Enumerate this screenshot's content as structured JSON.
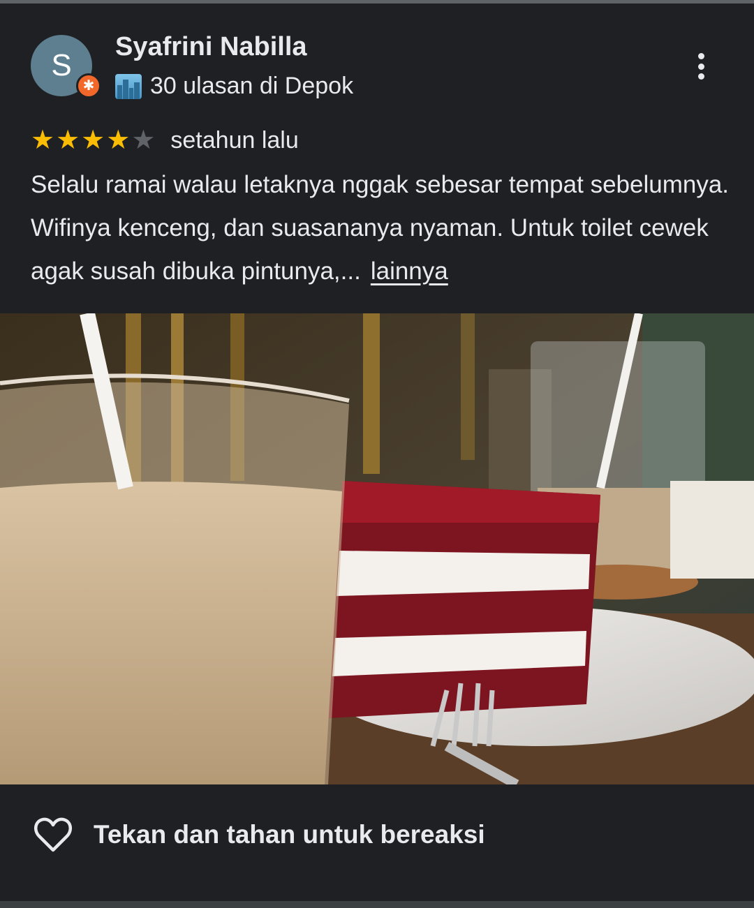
{
  "review": {
    "author_initial": "S",
    "author_name": "Syafrini Nabilla",
    "reviews_summary": "30 ulasan di Depok",
    "rating": 4,
    "rating_max": 5,
    "time_ago": "setahun lalu",
    "text": "Selalu ramai walau letaknya nggak sebesar tempat sebelumnya. Wifinya kenceng, dan suasananya nyaman. Untuk toilet cewek agak susah dibuka pintunya,...",
    "more_label": "lainnya",
    "badge_icon": "local-guide-icon",
    "city_icon": "cityscape-icon"
  },
  "actions": {
    "react_label": "Tekan dan tahan untuk bereaksi",
    "react_icon": "heart-outline-icon",
    "more_icon": "more-vert-icon"
  },
  "colors": {
    "background": "#1f2023",
    "avatar": "#5e7f8f",
    "badge": "#f2682a",
    "star_on": "#fbbc04",
    "star_off": "#5f6368"
  }
}
